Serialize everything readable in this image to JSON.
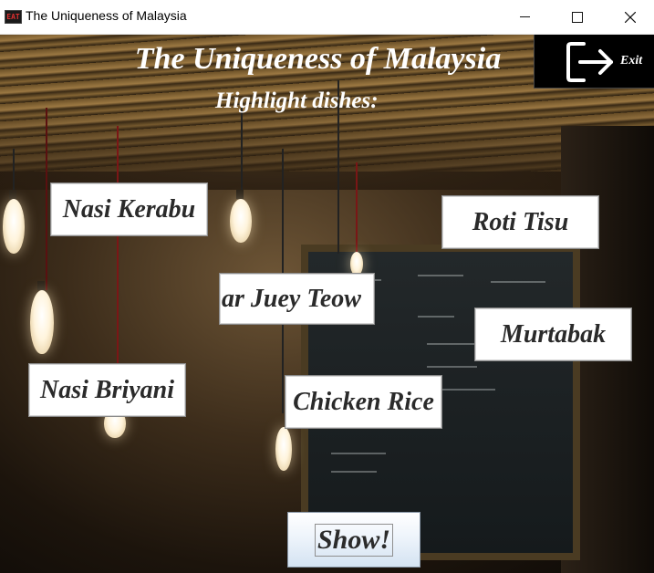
{
  "window": {
    "title": "The Uniqueness of Malaysia",
    "icon": "app-logo-icon",
    "controls": [
      "minimize-icon",
      "maximize-icon",
      "close-icon"
    ]
  },
  "header": {
    "title": "The Uniqueness of Malaysia",
    "subtitle": "Highlight dishes:"
  },
  "exit": {
    "label": "Exit",
    "icon": "exit-door-arrow-icon"
  },
  "dishes": [
    {
      "label": "Nasi Kerabu"
    },
    {
      "label": "Roti Tisu"
    },
    {
      "label": "ar Juey Teow"
    },
    {
      "label": "Murtabak"
    },
    {
      "label": "Nasi Briyani"
    },
    {
      "label": "Chicken Rice"
    }
  ],
  "action": {
    "show_label": "Show!"
  },
  "colors": {
    "title_text": "#ffffff",
    "button_bg": "#ffffff",
    "button_text": "#2a2a2a",
    "exit_bg": "#000000",
    "show_gradient_end": "#d4e3f2"
  }
}
